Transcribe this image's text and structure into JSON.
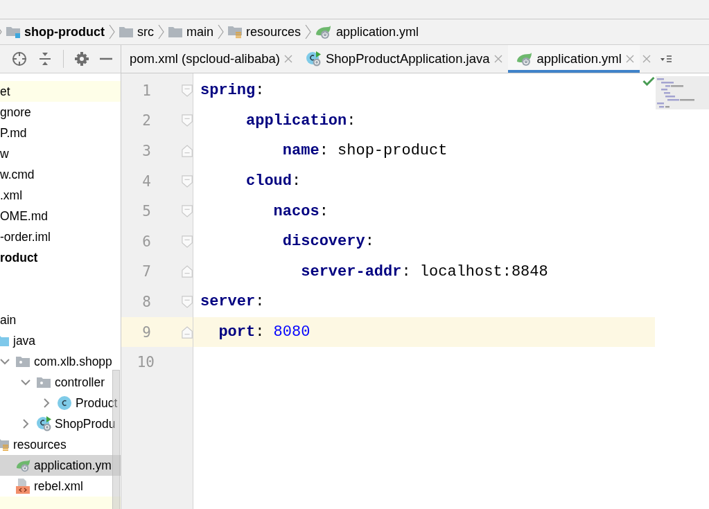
{
  "breadcrumb": [
    {
      "label": "shop-product",
      "kind": "module"
    },
    {
      "label": "src",
      "kind": "folder"
    },
    {
      "label": "main",
      "kind": "folder"
    },
    {
      "label": "resources",
      "kind": "resources-folder"
    },
    {
      "label": "application.yml",
      "kind": "yaml"
    }
  ],
  "tabs": [
    {
      "label": "pom.xml (spcloud-alibaba)",
      "selected": false
    },
    {
      "label": "ShopProductApplication.java",
      "kind": "spring-class",
      "selected": false
    },
    {
      "label": "application.yml",
      "kind": "yaml",
      "selected": true
    }
  ],
  "tree": [
    {
      "label": "et",
      "excluded": true,
      "selected": false
    },
    {
      "label": "gnore",
      "excluded": false,
      "selected": false
    },
    {
      "label": "P.md",
      "excluded": false,
      "selected": false
    },
    {
      "label": "w",
      "excluded": false,
      "selected": false
    },
    {
      "label": "w.cmd",
      "excluded": false,
      "selected": false
    },
    {
      "label": ".xml",
      "excluded": false,
      "selected": false
    },
    {
      "label": "OME.md",
      "excluded": false,
      "selected": false
    },
    {
      "label": "-order.iml",
      "excluded": false,
      "selected": false
    },
    {
      "label": "roduct",
      "kind": "module",
      "excluded": false,
      "selected": false
    },
    {
      "kind": "blank"
    },
    {
      "kind": "blank"
    },
    {
      "label": "ain",
      "excluded": false,
      "selected": false,
      "children": [
        {
          "label": "java",
          "kind": "source-folder",
          "excluded": false,
          "selected": false,
          "children": [
            {
              "label": "com.xlb.shopp",
              "kind": "package",
              "expanded": true,
              "excluded": false,
              "selected": false,
              "children": [
                {
                  "label": "controller",
                  "kind": "package",
                  "expanded": true,
                  "excluded": false,
                  "selected": false,
                  "children": [
                    {
                      "label": "Product",
                      "kind": "class",
                      "expanded": false,
                      "excluded": false,
                      "selected": false
                    }
                  ]
                },
                {
                  "label": "ShopProdu",
                  "kind": "spring-class",
                  "expanded": false,
                  "excluded": false,
                  "selected": false
                }
              ]
            }
          ]
        },
        {
          "label": "resources",
          "kind": "resources-folder",
          "excluded": false,
          "selected": false,
          "children": [
            {
              "label": "application.ym",
              "kind": "yaml",
              "excluded": false,
              "selected": true
            },
            {
              "label": "rebel.xml",
              "kind": "xml",
              "excluded": false,
              "selected": false
            }
          ]
        }
      ]
    },
    {
      "excluded": true,
      "selected": false
    }
  ],
  "editor": {
    "lines": [
      {
        "number": "1",
        "text": "spring",
        "sep": ":",
        "current_line": false
      },
      {
        "number": "2",
        "text": "     application",
        "sep": ":",
        "current_line": false
      },
      {
        "number": "3",
        "text": "         name",
        "sep": ":",
        "value": " shop-product",
        "current_line": false
      },
      {
        "number": "4",
        "text": "     cloud",
        "sep": ":",
        "current_line": false
      },
      {
        "number": "5",
        "text": "        nacos",
        "sep": ":",
        "current_line": false
      },
      {
        "number": "6",
        "text": "         discovery",
        "sep": ":",
        "current_line": false
      },
      {
        "number": "7",
        "text": "           server-addr",
        "sep": ":",
        "value": " localhost:8848",
        "current_line": false
      },
      {
        "number": "8",
        "text": "server",
        "sep": ":",
        "current_line": false
      },
      {
        "number": "9",
        "text": "  port",
        "sep": ":",
        "value": " 8080",
        "kind": "number",
        "current_line": true
      },
      {
        "number": "10",
        "current_line": false
      }
    ]
  }
}
